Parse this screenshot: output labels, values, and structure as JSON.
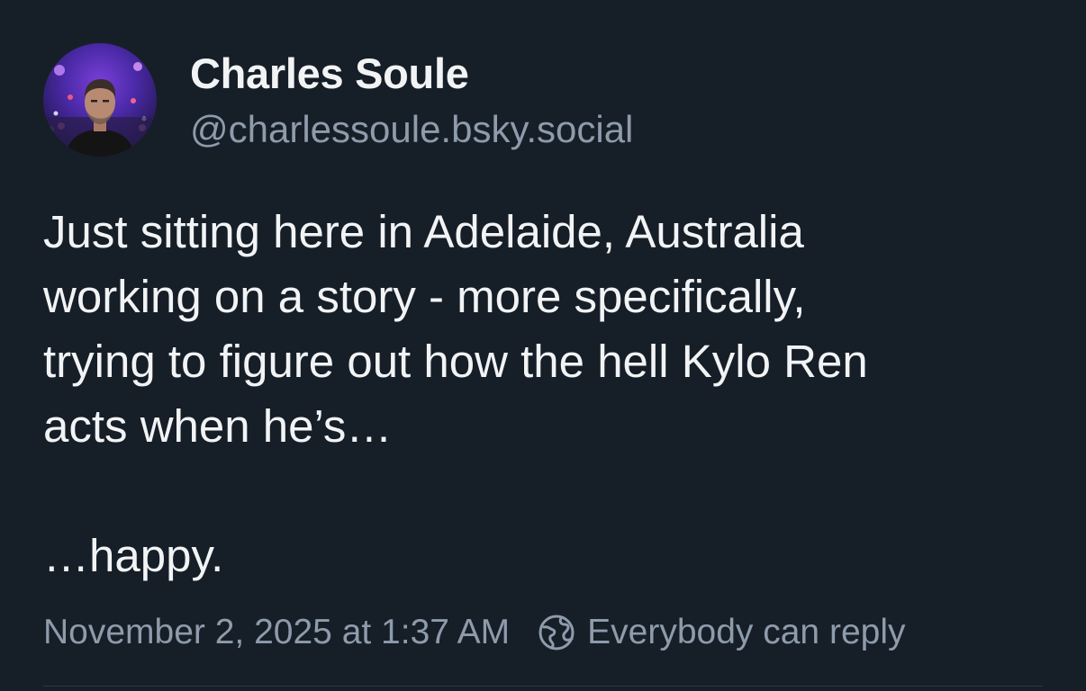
{
  "post": {
    "author": {
      "display_name": "Charles Soule",
      "handle": "@charlessoule.bsky.social"
    },
    "text": {
      "line_1": "Just sitting here in Adelaide, Australia",
      "line_2": "working on a story - more specifically,",
      "line_3": "trying to figure out how the hell Kylo Ren",
      "line_4": "acts when he’s…",
      "line_5": "…happy."
    },
    "timestamp": "November 2, 2025 at 1:37 AM",
    "reply_setting": {
      "label": "Everybody can reply",
      "icon": "globe-icon"
    }
  },
  "colors": {
    "background": "#161e27",
    "primary_text": "#f1f3f5",
    "secondary_text": "#8d9bab"
  }
}
